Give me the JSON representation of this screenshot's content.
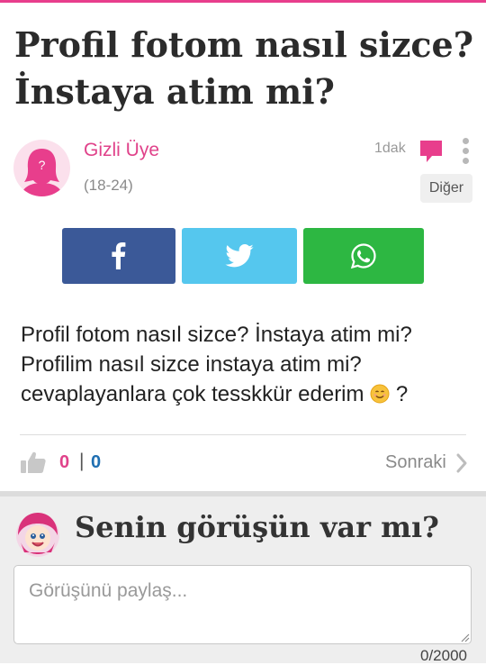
{
  "header": {
    "accent_color": "#e83e8c"
  },
  "question": {
    "title": "Profil fotom nasıl sizce? İnstaya atim mi?",
    "body_line1": "Profil fotom nasıl sizce? İnstaya atim mi?",
    "body_line2": "Profilim nasıl sizce instaya atim mi?",
    "body_line3": "cevaplayanlara çok tesskkür ederim",
    "body_line3_suffix": " ?",
    "body_emoji_icon": "smiling-face-icon"
  },
  "author": {
    "name": "Gizli Üye",
    "age": "(18-24)",
    "avatar_icon": "anonymous-female-avatar-icon",
    "time": "1dak",
    "other_label": "Diğer"
  },
  "share": {
    "facebook_icon": "facebook-icon",
    "facebook_color": "#3b5998",
    "twitter_icon": "twitter-icon",
    "twitter_color": "#55c7ee",
    "whatsapp_icon": "whatsapp-icon",
    "whatsapp_color": "#2db742"
  },
  "votes": {
    "likes": "0",
    "separator": "|",
    "dislikes": "0",
    "next_label": "Sonraki"
  },
  "comment": {
    "prompt": "Senin görüşün var mı?",
    "placeholder": "Görüşünü paylaş...",
    "counter": "0/2000"
  }
}
